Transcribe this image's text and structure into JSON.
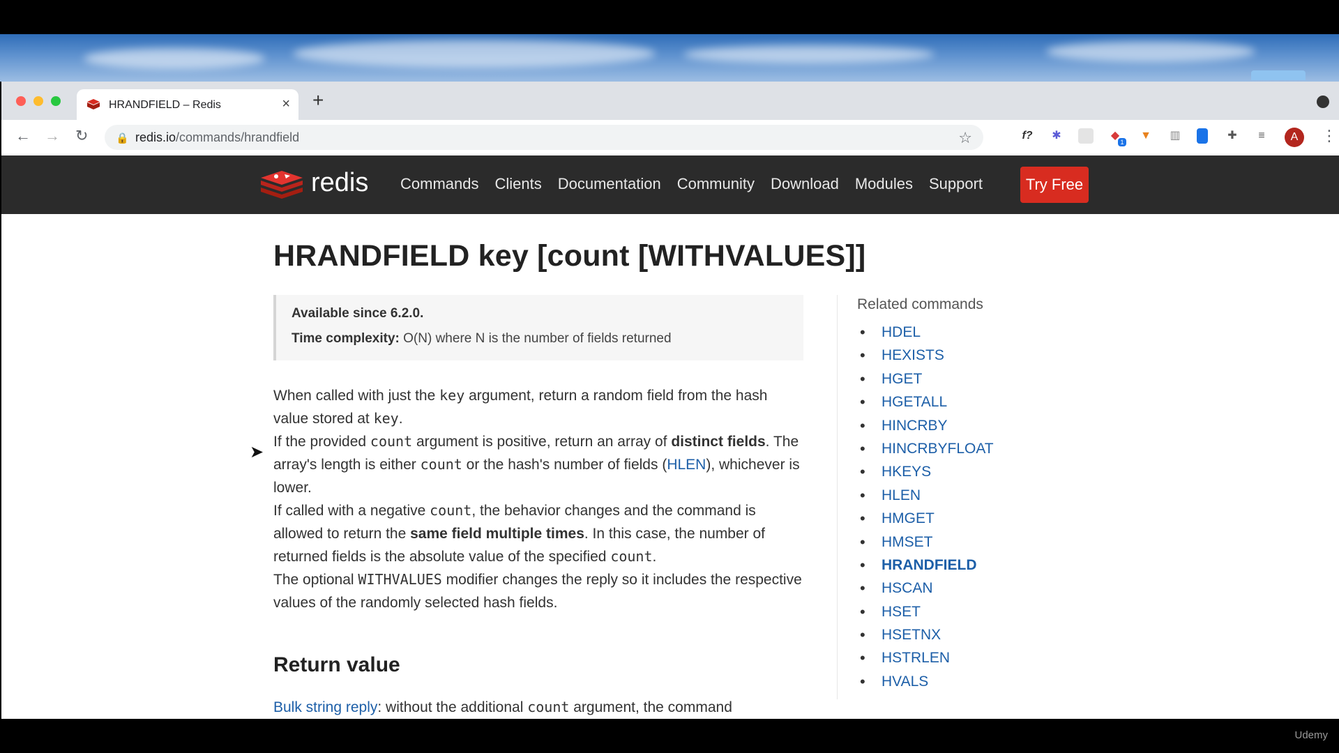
{
  "browser": {
    "tab_title": "HRANDFIELD – Redis",
    "url_host": "redis.io",
    "url_path": "/commands/hrandfield",
    "avatar_initial": "A",
    "ext_fn_label": "f?",
    "ext_badge": "1"
  },
  "site_nav": {
    "logo_text": "redis",
    "links": [
      "Commands",
      "Clients",
      "Documentation",
      "Community",
      "Download",
      "Modules",
      "Support"
    ],
    "cta": "Try Free"
  },
  "page": {
    "title": "HRANDFIELD key [count [WITHVALUES]]",
    "available_since": "Available since 6.2.0.",
    "time_complexity_label": "Time complexity:",
    "time_complexity_value": "O(N) where N is the number of fields returned",
    "p1": {
      "a": "When called with just the ",
      "code1": "key",
      "b": " argument, return a random field from the hash value stored at ",
      "code2": "key",
      "c": "."
    },
    "p2": {
      "a": "If the provided ",
      "code1": "count",
      "b": " argument is positive, return an array of ",
      "bold": "distinct fields",
      "c": ". The array's length is either ",
      "code2": "count",
      "d": " or the hash's number of fields (",
      "link": "HLEN",
      "e": "), whichever is lower."
    },
    "p3": {
      "a": "If called with a negative ",
      "code1": "count",
      "b": ", the behavior changes and the command is allowed to return the ",
      "bold": "same field multiple times",
      "c": ". In this case, the number of returned fields is the absolute value of the specified ",
      "code2": "count",
      "d": "."
    },
    "p4": {
      "a": "The optional ",
      "code1": "WITHVALUES",
      "b": " modifier changes the reply so it includes the respective values of the randomly selected hash fields."
    },
    "return_heading": "Return value",
    "p5": {
      "link": "Bulk string reply",
      "a": ": without the additional ",
      "code1": "count",
      "b": " argument, the command"
    },
    "related_title": "Related commands",
    "related_commands": [
      "HDEL",
      "HEXISTS",
      "HGET",
      "HGETALL",
      "HINCRBY",
      "HINCRBYFLOAT",
      "HKEYS",
      "HLEN",
      "HMGET",
      "HMSET",
      "HRANDFIELD",
      "HSCAN",
      "HSET",
      "HSETNX",
      "HSTRLEN",
      "HVALS"
    ],
    "related_current": "HRANDFIELD"
  },
  "watermark": "Udemy",
  "colors": {
    "nav_bg": "#2b2b2b",
    "cta_bg": "#d82c20",
    "link": "#1d5fa8"
  }
}
